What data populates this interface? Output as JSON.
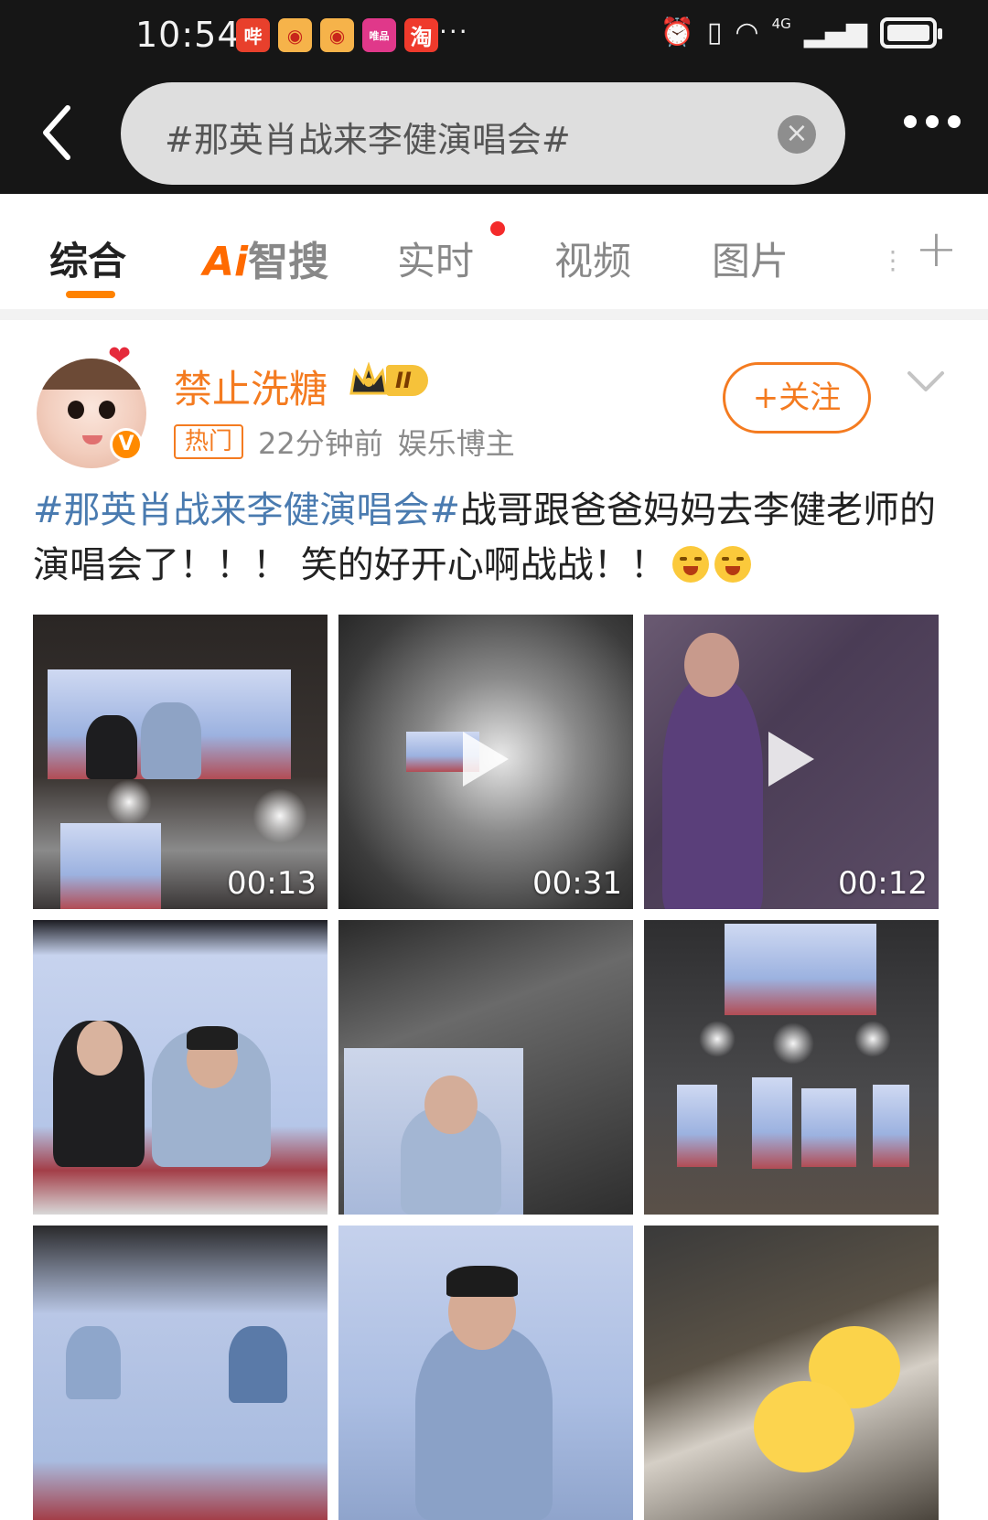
{
  "status_bar": {
    "time": "10:54",
    "notification_icons": [
      "bilibili-icon",
      "weibo-icon",
      "weibo-icon",
      "vipshop-icon",
      "taobao-icon"
    ],
    "more": "···",
    "network": "4G"
  },
  "search": {
    "query": "#那英肖战来李健演唱会#",
    "clear": "×"
  },
  "tabs": {
    "items": [
      {
        "label": "综合",
        "active": true
      },
      {
        "label_ai": "Ai",
        "label": "智搜"
      },
      {
        "label": "实时",
        "badge": "red-dot"
      },
      {
        "label": "视频"
      },
      {
        "label": "图片"
      }
    ],
    "more": "+"
  },
  "post": {
    "username": "禁止洗糖",
    "level": "II",
    "hot_tag": "热门",
    "time": "22分钟前",
    "role": "娱乐博主",
    "follow_label": "+关注",
    "verified": "V",
    "topic": "#那英肖战来李健演唱会#",
    "text": "战哥跟爸爸妈妈去李健老师的演唱会了！！！ 笑的好开心啊战战！！",
    "media": [
      {
        "type": "video",
        "duration": "00:13"
      },
      {
        "type": "video",
        "duration": "00:31"
      },
      {
        "type": "video",
        "duration": "00:12"
      },
      {
        "type": "image"
      },
      {
        "type": "image"
      },
      {
        "type": "image"
      },
      {
        "type": "image"
      },
      {
        "type": "image"
      },
      {
        "type": "image"
      }
    ]
  },
  "colors": {
    "accent": "#ff8200",
    "username": "#f47b20",
    "topic_link": "#4a7bb0",
    "top_bar": "#161616"
  }
}
